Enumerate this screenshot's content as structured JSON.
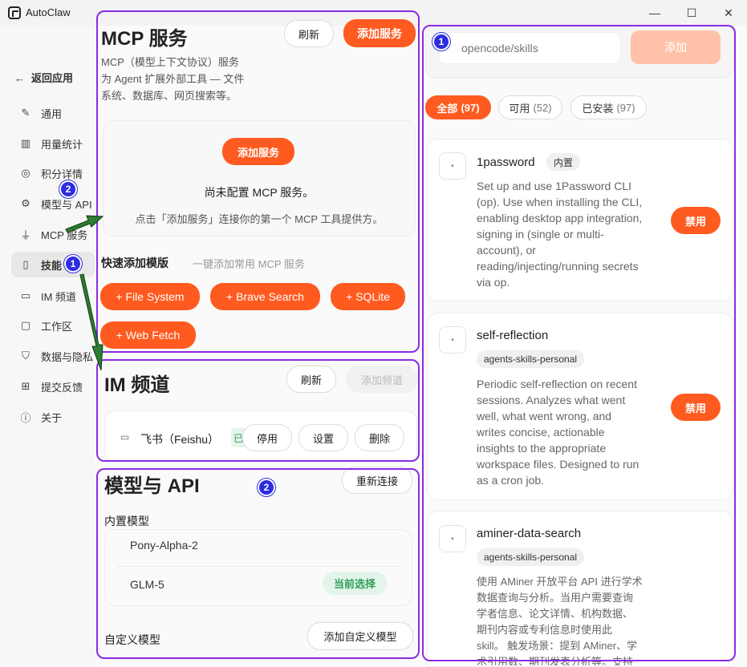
{
  "window": {
    "title": "AutoClaw",
    "minimize": "—",
    "maximize": "☐",
    "close": "✕"
  },
  "sidebar": {
    "back": "返回应用",
    "items": [
      {
        "icon": "✎",
        "label": "通用"
      },
      {
        "icon": "▥",
        "label": "用量统计"
      },
      {
        "icon": "◎",
        "label": "积分详情"
      },
      {
        "icon": "⚙",
        "label": "模型与 API"
      },
      {
        "icon": "⏚",
        "label": "MCP 服务"
      },
      {
        "icon": "▯",
        "label": "技能"
      },
      {
        "icon": "▭",
        "label": "IM 频道"
      },
      {
        "icon": "▢",
        "label": "工作区"
      },
      {
        "icon": "⛉",
        "label": "数据与隐私"
      },
      {
        "icon": "⊞",
        "label": "提交反馈"
      },
      {
        "icon": "ⓘ",
        "label": "关于"
      }
    ]
  },
  "mcp": {
    "title": "MCP 服务",
    "refresh": "刷新",
    "add": "添加服务",
    "desc_lines": [
      "MCP（模型上下文协议）服务",
      "为 Agent 扩展外部工具 — 文件",
      "系统、数据库、网页搜索等。"
    ],
    "empty_add": "添加服务",
    "empty_title": "尚未配置 MCP 服务。",
    "empty_hint": "点击「添加服务」连接你的第一个 MCP 工具提供方。",
    "quick_title": "快速添加模版",
    "quick_hint": "一键添加常用 MCP 服务",
    "templates": [
      "+ File System",
      "+ Brave Search",
      "+ SQLite",
      "+ Web Fetch"
    ]
  },
  "im": {
    "title": "IM 频道",
    "refresh": "刷新",
    "add": "添加频道",
    "channel_name": "飞书（Feishu）",
    "status": "已",
    "stop": "停用",
    "settings": "设置",
    "delete": "删除"
  },
  "model": {
    "title": "模型与 API",
    "reconnect": "重新连接",
    "builtin_title": "内置模型",
    "models": [
      "Pony-Alpha-2",
      "GLM-5"
    ],
    "current_badge": "当前选择",
    "custom_title": "自定义模型",
    "add_custom": "添加自定义模型"
  },
  "skills": {
    "search_placeholder": "opencode/skills",
    "add": "添加",
    "filters": [
      {
        "label": "全部",
        "count": "(97)"
      },
      {
        "label": "可用",
        "count": "(52)"
      },
      {
        "label": "已安装",
        "count": "(97)"
      }
    ],
    "items": [
      {
        "name": "1password",
        "tag": "内置",
        "lines": [
          "Set up and use 1Password CLI",
          "(op). Use when installing the CLI,",
          "enabling desktop app integration,",
          "signing in (single or multi-",
          "account), or",
          "reading/injecting/running secrets",
          "via op."
        ],
        "action": "禁用"
      },
      {
        "name": "self-reflection",
        "tag": "agents-skills-personal",
        "lines": [
          "Periodic self-reflection on recent",
          "sessions. Analyzes what went",
          "well, what went wrong, and",
          "writes concise, actionable",
          "insights to the appropriate",
          "workspace files. Designed to run",
          "as a cron job."
        ],
        "action": "禁用"
      },
      {
        "name": "aminer-data-search",
        "tag": "agents-skills-personal",
        "lines": [
          "使用 AMiner 开放平台 API 进行学术",
          "数据查询与分析。当用户需要查询",
          "学者信息、论文详情、机构数据、",
          "期刊内容或专利信息时使用此",
          "skill。 触发场景：提到 AMiner、学",
          "术引用数、期刊发表分析等。支持"
        ]
      }
    ]
  },
  "annotations": {
    "left_badge_1": "1",
    "left_badge_2": "2",
    "right_badge_1": "1",
    "right_badge_2": "2"
  },
  "colors": {
    "accent": "#ff5a1f",
    "annotation": "#8a2be2",
    "badge": "#2d2de0",
    "success": "#2f9e58"
  }
}
